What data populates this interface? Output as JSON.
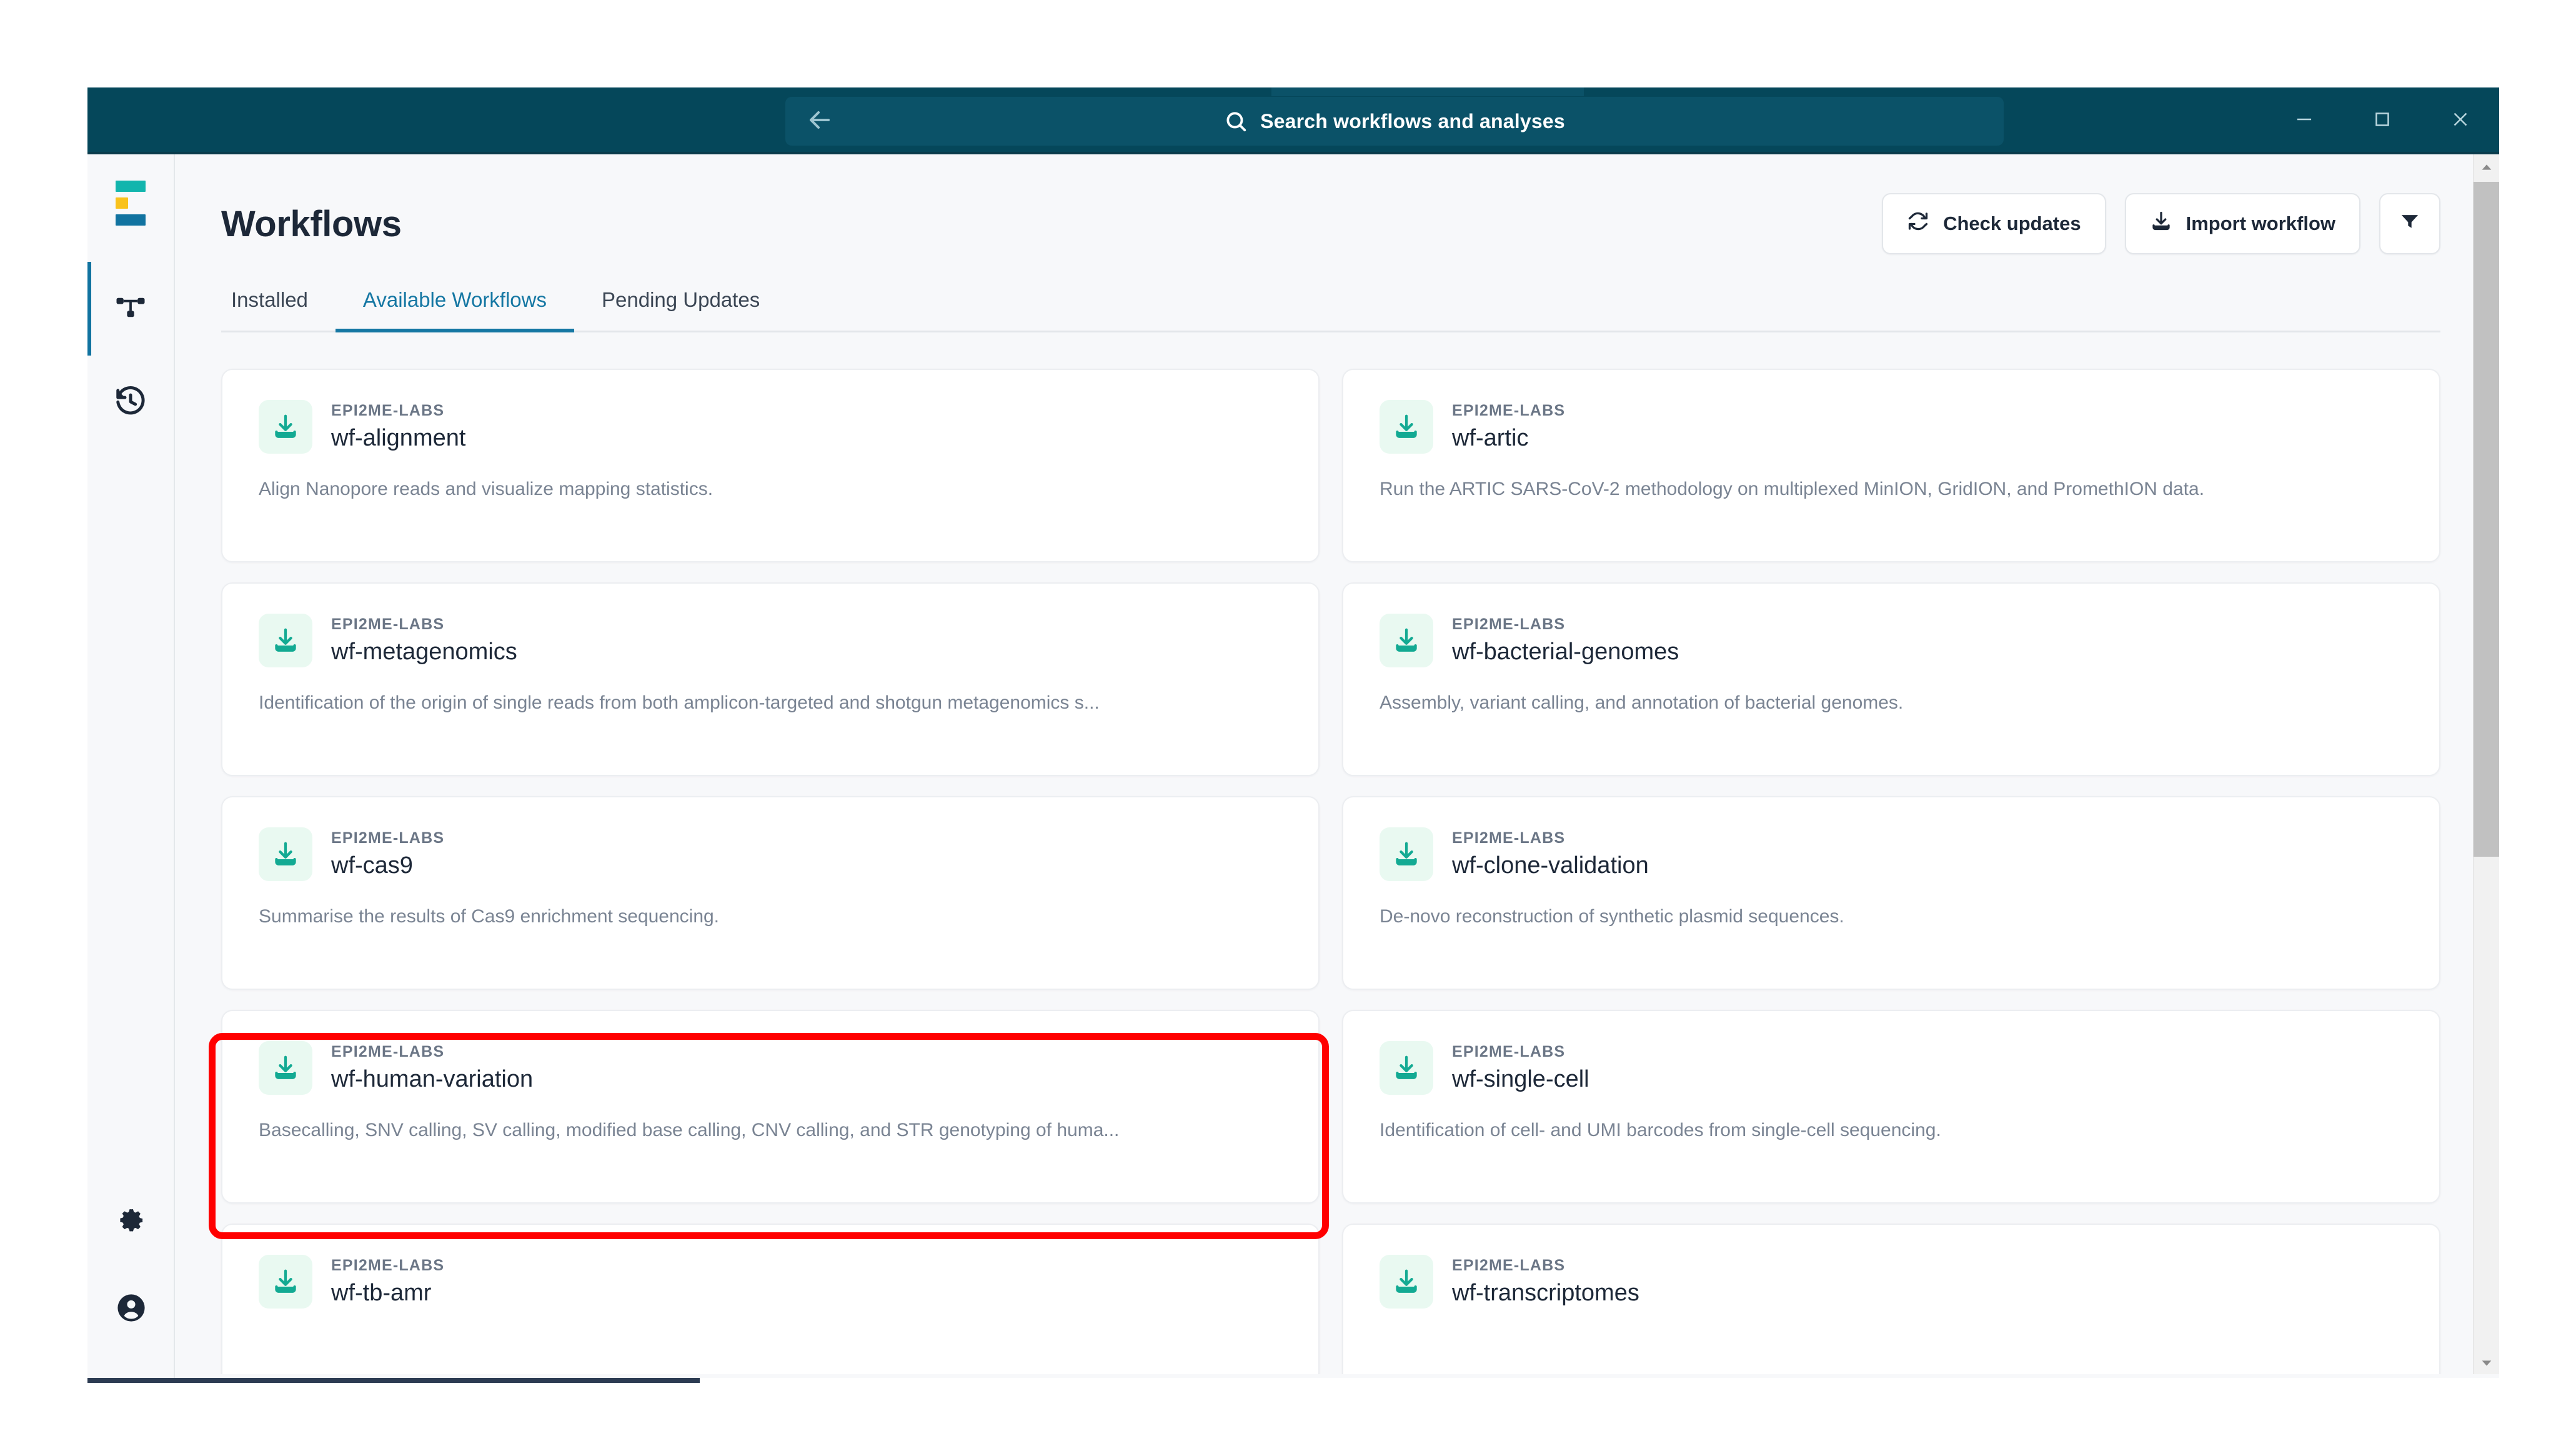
{
  "titlebar": {
    "back_icon": "arrow-left-icon",
    "search_icon": "search-icon",
    "search_placeholder": "Search workflows and analyses",
    "minimize_label": "Minimize",
    "maximize_label": "Maximize",
    "close_label": "Close"
  },
  "sidebar": {
    "logo_name": "epi2me-logo",
    "items": [
      {
        "name": "workflows",
        "icon": "workflow-nodes-icon",
        "active": true
      },
      {
        "name": "history",
        "icon": "history-clock-icon",
        "active": false
      }
    ],
    "bottom_items": [
      {
        "name": "settings",
        "icon": "gear-icon"
      },
      {
        "name": "account",
        "icon": "account-circle-icon"
      }
    ]
  },
  "header": {
    "title": "Workflows",
    "check_updates_label": "Check updates",
    "check_updates_icon": "refresh-icon",
    "import_workflow_label": "Import workflow",
    "import_workflow_icon": "download-icon",
    "filter_icon": "filter-funnel-icon"
  },
  "tabs": [
    {
      "label": "Installed",
      "active": false
    },
    {
      "label": "Available Workflows",
      "active": true
    },
    {
      "label": "Pending Updates",
      "active": false
    }
  ],
  "colors": {
    "titlebar_bg": "#05475a",
    "accent_tab": "#1577a3",
    "card_icon_teal": "#13aa93",
    "highlight_red": "#ff0000",
    "logo_teal": "#12b5ad",
    "logo_yellow": "#f9c21b",
    "logo_blue": "#1173a0"
  },
  "cards": [
    {
      "vendor": "EPI2ME-LABS",
      "name": "wf-alignment",
      "description": "Align Nanopore reads and visualize mapping statistics.",
      "icon": "download-icon",
      "highlighted": false
    },
    {
      "vendor": "EPI2ME-LABS",
      "name": "wf-artic",
      "description": "Run the ARTIC SARS-CoV-2 methodology on multiplexed MinION, GridION, and PromethION data.",
      "icon": "download-icon",
      "highlighted": false
    },
    {
      "vendor": "EPI2ME-LABS",
      "name": "wf-metagenomics",
      "description": "Identification of the origin of single reads from both amplicon-targeted and shotgun metagenomics s...",
      "icon": "download-icon",
      "highlighted": false
    },
    {
      "vendor": "EPI2ME-LABS",
      "name": "wf-bacterial-genomes",
      "description": "Assembly, variant calling, and annotation of bacterial genomes.",
      "icon": "download-icon",
      "highlighted": false
    },
    {
      "vendor": "EPI2ME-LABS",
      "name": "wf-cas9",
      "description": "Summarise the results of Cas9 enrichment sequencing.",
      "icon": "download-icon",
      "highlighted": false
    },
    {
      "vendor": "EPI2ME-LABS",
      "name": "wf-clone-validation",
      "description": "De-novo reconstruction of synthetic plasmid sequences.",
      "icon": "download-icon",
      "highlighted": false
    },
    {
      "vendor": "EPI2ME-LABS",
      "name": "wf-human-variation",
      "description": "Basecalling, SNV calling, SV calling, modified base calling, CNV calling, and STR genotyping of huma...",
      "icon": "download-icon",
      "highlighted": true
    },
    {
      "vendor": "EPI2ME-LABS",
      "name": "wf-single-cell",
      "description": "Identification of cell- and UMI barcodes from single-cell sequencing.",
      "icon": "download-icon",
      "highlighted": false
    },
    {
      "vendor": "EPI2ME-LABS",
      "name": "wf-tb-amr",
      "description": "",
      "icon": "download-icon",
      "highlighted": false
    },
    {
      "vendor": "EPI2ME-LABS",
      "name": "wf-transcriptomes",
      "description": "",
      "icon": "download-icon",
      "highlighted": false
    }
  ],
  "scrollbar": {
    "up_icon": "chevron-up-icon",
    "down_icon": "chevron-down-icon"
  }
}
